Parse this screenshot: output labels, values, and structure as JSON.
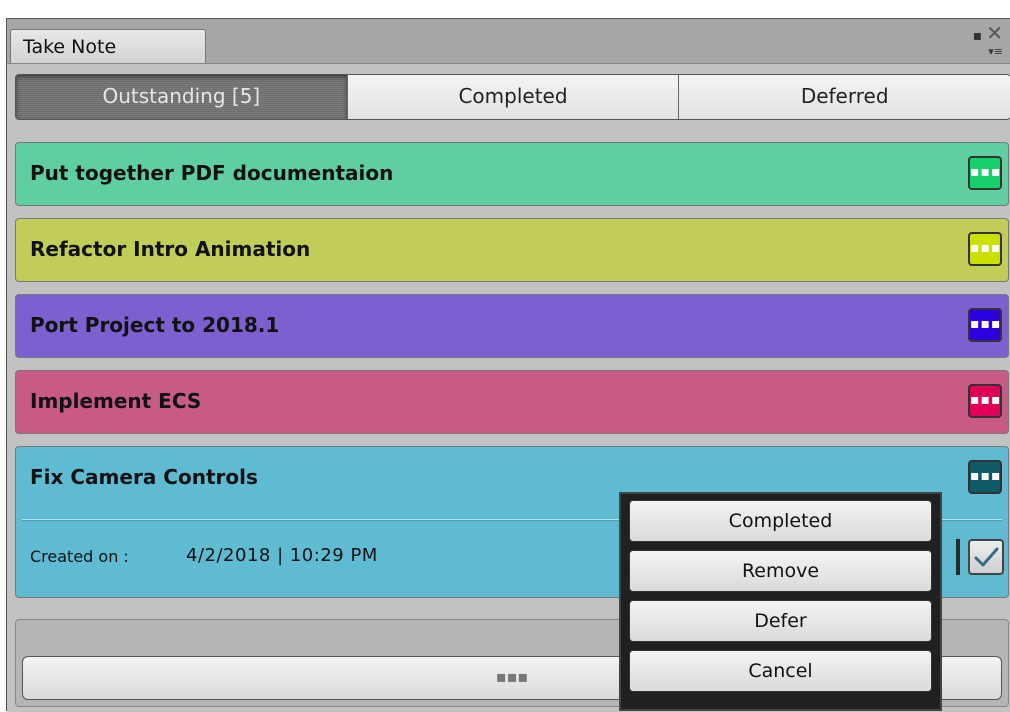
{
  "window": {
    "tab_title": "Take Note",
    "icons": [
      "restore-icon",
      "close-icon",
      "menu-icon"
    ]
  },
  "filters": {
    "outstanding": "Outstanding [5]",
    "completed": "Completed",
    "deferred": "Deferred",
    "active": "outstanding"
  },
  "tasks": [
    {
      "title": "Put together PDF documentaion",
      "color": "#5fcfa2",
      "button_color": "#16d16a"
    },
    {
      "title": "Refactor Intro Animation",
      "color": "#c2cd58",
      "button_color": "#c9e000"
    },
    {
      "title": "Port Project to 2018.1",
      "color": "#7c60d0",
      "button_color": "#2a00e0"
    },
    {
      "title": "Implement ECS",
      "color": "#c85a86",
      "button_color": "#e00058"
    },
    {
      "title": "Fix Camera Controls",
      "color": "#5fbbd2",
      "button_color": "#0e5a66",
      "created_label": "Created on :",
      "created_value": "4/2/2018 | 10:29 PM"
    }
  ],
  "task_menu_glyph": "▪▪▪",
  "add_button_glyph": "▪▪▪",
  "context_menu": {
    "completed": "Completed",
    "remove": "Remove",
    "defer": "Defer",
    "cancel": "Cancel"
  }
}
